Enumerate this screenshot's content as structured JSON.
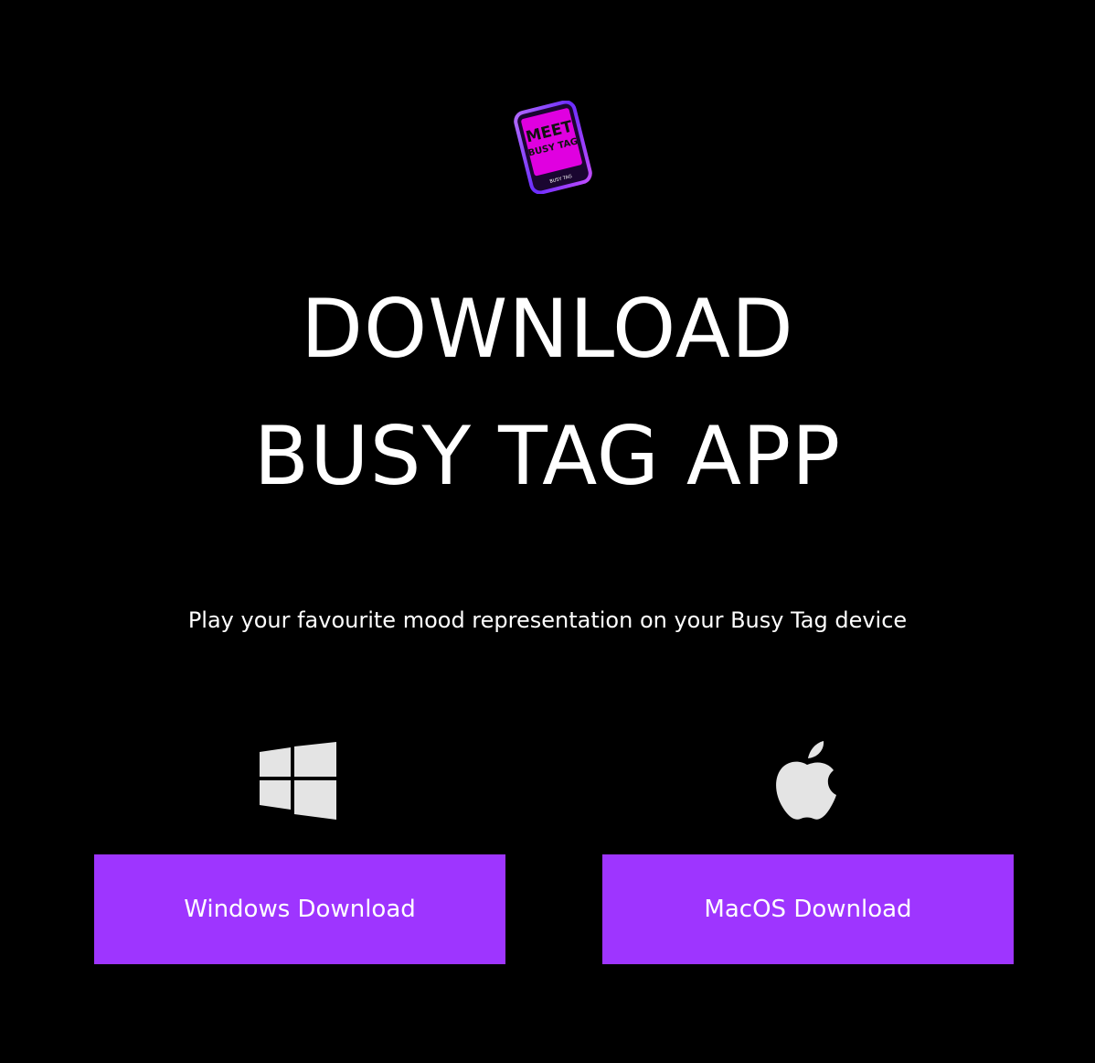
{
  "logo": {
    "line1": "MEET",
    "line2": "BUSY TAG",
    "footer": "BUSY TAG"
  },
  "hero": {
    "title_line1": "DOWNLOAD",
    "title_line2": "BUSY TAG APP",
    "subtitle": "Play your favourite mood representation on your Busy Tag device"
  },
  "downloads": {
    "windows": {
      "icon": "windows-logo-icon",
      "label": "Windows Download"
    },
    "macos": {
      "icon": "apple-logo-icon",
      "label": "MacOS Download"
    }
  },
  "colors": {
    "background": "#000000",
    "accent": "#9e35ff",
    "logo_magenta": "#e000e0",
    "icon_gray": "#e4e4e4",
    "text": "#ffffff"
  }
}
